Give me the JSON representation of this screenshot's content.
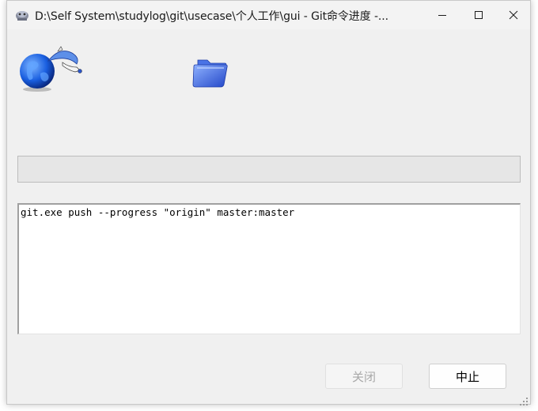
{
  "window": {
    "title": "D:\\Self System\\studylog\\git\\usecase\\个人工作\\gui - Git命令进度 -..."
  },
  "icons": {
    "app": "git-gui-icon",
    "animation": "globe-with-comet-icon",
    "folder": "folder-icon"
  },
  "progress": {
    "value": 0
  },
  "log": {
    "text": "git.exe push --progress \"origin\" master:master"
  },
  "buttons": {
    "close_label": "关闭",
    "close_enabled": false,
    "abort_label": "中止"
  },
  "colors": {
    "window_bg": "#f0f0f0",
    "progress_fill": "#06b025"
  }
}
